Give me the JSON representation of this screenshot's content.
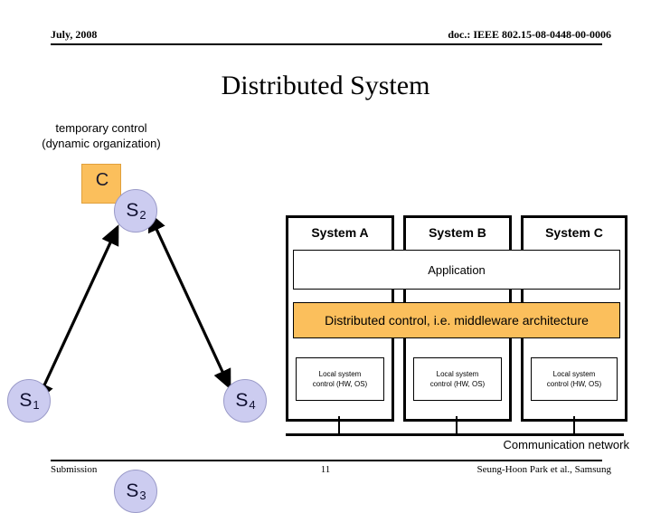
{
  "header": {
    "date": "July, 2008",
    "doc_id": "doc.: IEEE 802.15-08-0448-00-0006"
  },
  "title": "Distributed System",
  "graph": {
    "annotation_line1": "temporary control",
    "annotation_line2": "(dynamic organization)",
    "control_node": {
      "label": "C",
      "color": "#FBBF5C"
    },
    "node_color": "#CCCCF0",
    "nodes": [
      {
        "id": "s1",
        "base": "S",
        "sub": "1"
      },
      {
        "id": "s2",
        "base": "S",
        "sub": "2"
      },
      {
        "id": "s3",
        "base": "S",
        "sub": "3"
      },
      {
        "id": "s4",
        "base": "S",
        "sub": "4"
      }
    ]
  },
  "architecture": {
    "systems": [
      {
        "title": "System A",
        "local_line1": "Local system",
        "local_line2": "control (HW, OS)"
      },
      {
        "title": "System B",
        "local_line1": "Local system",
        "local_line2": "control (HW, OS)"
      },
      {
        "title": "System C",
        "local_line1": "Local system",
        "local_line2": "control (HW, OS)"
      }
    ],
    "application_band": "Application",
    "middleware_band": "Distributed control, i.e. middleware architecture",
    "middleware_color": "#FBBF5C",
    "network_label": "Communication network"
  },
  "footer": {
    "left": "Submission",
    "page": "11",
    "right": "Seung-Hoon Park et al., Samsung"
  }
}
